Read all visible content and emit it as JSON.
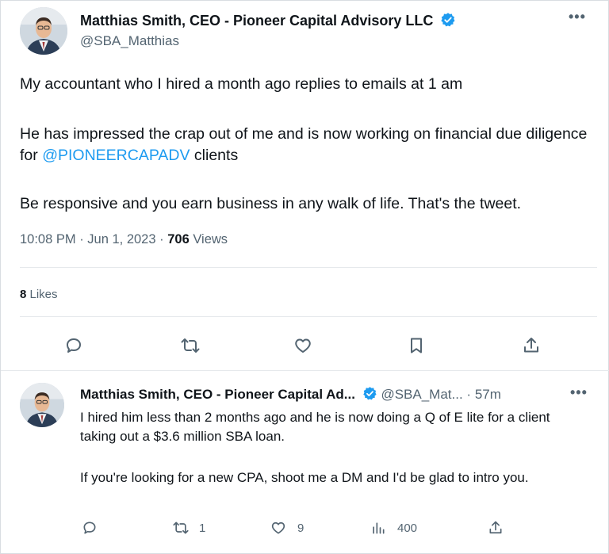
{
  "tweet": {
    "author_name": "Matthias Smith, CEO - Pioneer Capital Advisory LLC",
    "handle": "@SBA_Matthias",
    "more_label": "•••",
    "paragraph_1": "My accountant who I hired a month ago replies to emails at 1 am",
    "paragraph_2_before": "He has impressed the crap out of me and is now working on financial due diligence for ",
    "paragraph_2_mention": "@PIONEERCAPADV",
    "paragraph_2_after": " clients",
    "paragraph_3": "Be responsive and you earn business in any walk of life. That's the tweet.",
    "time": "10:08 PM",
    "date": "Jun 1, 2023",
    "separator": " · ",
    "views_count": "706",
    "views_label": " Views",
    "likes_count": "8",
    "likes_label": " Likes",
    "actions": {
      "reply_icon": "reply-icon",
      "retweet_icon": "retweet-icon",
      "like_icon": "heart-icon",
      "bookmark_icon": "bookmark-icon",
      "share_icon": "share-icon"
    }
  },
  "reply": {
    "author_name": "Matthias Smith, CEO - Pioneer Capital Ad...",
    "handle": "@SBA_Mat...",
    "time": "57m",
    "separator": " · ",
    "more_label": "•••",
    "paragraph_1": "I hired him less than 2 months ago and he is now doing a Q of E lite for a client taking out a $3.6 million SBA loan.",
    "paragraph_2": "If you're looking for a new CPA, shoot me a DM and I'd be glad to intro you.",
    "retweet_count": "1",
    "like_count": "9",
    "views_count": "400"
  },
  "colors": {
    "accent": "#1d9bf0",
    "text": "#0f1419",
    "secondary": "#536471",
    "verified": "#1d9bf0"
  }
}
